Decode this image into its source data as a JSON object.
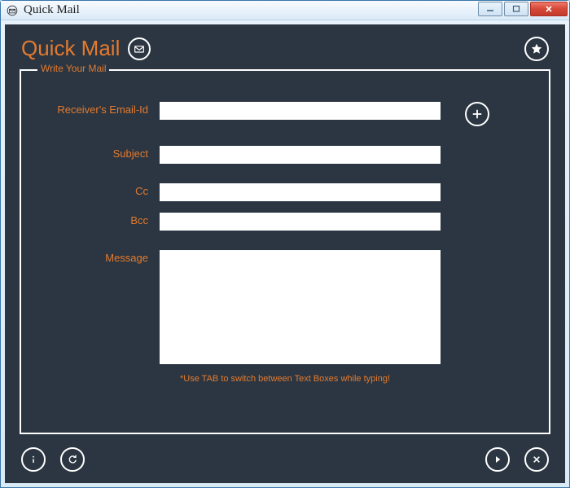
{
  "window": {
    "title": "Quick Mail"
  },
  "header": {
    "app_title": "Quick Mail"
  },
  "form": {
    "legend": "Write Your Mail",
    "labels": {
      "receiver": "Receiver's Email-Id",
      "subject": "Subject",
      "cc": "Cc",
      "bcc": "Bcc",
      "message": "Message"
    },
    "values": {
      "receiver": "",
      "subject": "",
      "cc": "",
      "bcc": "",
      "message": ""
    },
    "hint": "*Use TAB to switch between Text Boxes while typing!"
  }
}
